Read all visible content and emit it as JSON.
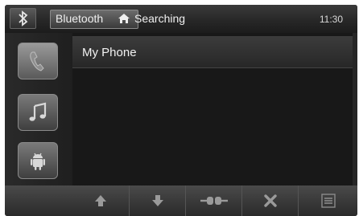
{
  "header": {
    "section_title": "Bluetooth",
    "status": "Searching",
    "clock": "11:30"
  },
  "sidebar": {
    "items": [
      {
        "icon": "phone-icon",
        "active": true
      },
      {
        "icon": "music-note-icon",
        "active": false
      },
      {
        "icon": "android-icon",
        "active": false
      }
    ]
  },
  "devices": [
    {
      "name": "My Phone"
    }
  ],
  "bottom_bar": {
    "buttons": [
      {
        "icon": "arrow-up-icon"
      },
      {
        "icon": "arrow-down-icon"
      },
      {
        "icon": "connect-icon"
      },
      {
        "icon": "close-icon"
      },
      {
        "icon": "menu-icon"
      }
    ]
  },
  "colors": {
    "background": "#111111",
    "text": "#f0f0f0"
  }
}
